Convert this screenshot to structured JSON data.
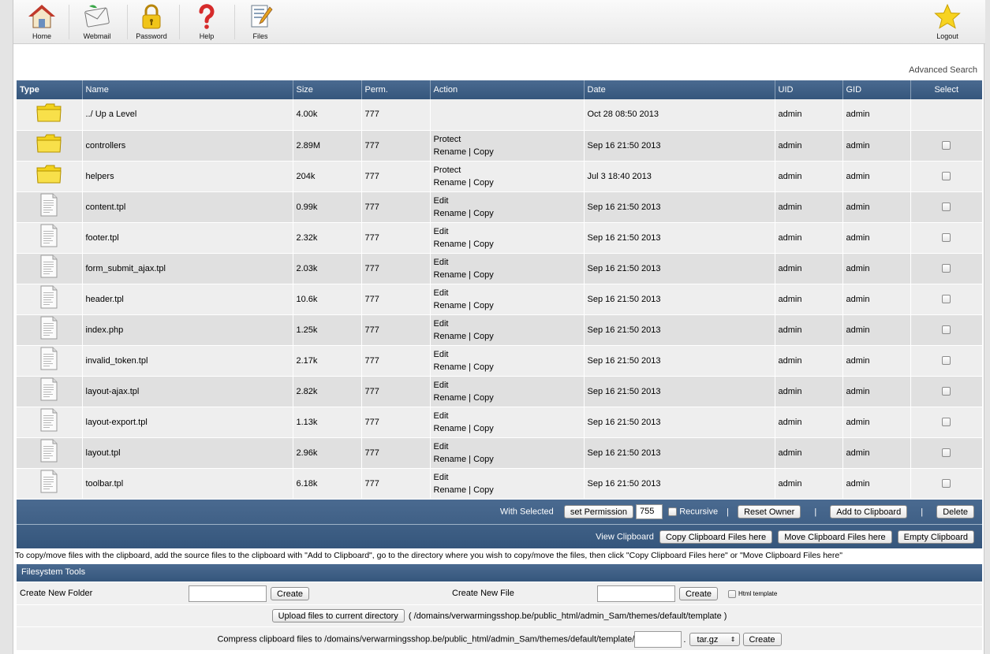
{
  "toolbar": {
    "items": [
      {
        "label": "Home",
        "icon": "home-icon"
      },
      {
        "label": "Webmail",
        "icon": "webmail-icon"
      },
      {
        "label": "Password",
        "icon": "lock-icon"
      },
      {
        "label": "Help",
        "icon": "help-icon"
      },
      {
        "label": "Files",
        "icon": "files-icon"
      }
    ],
    "logout": {
      "label": "Logout",
      "icon": "star-icon"
    }
  },
  "advanced_search": "Advanced Search",
  "columns": [
    "Type",
    "Name",
    "Size",
    "Perm.",
    "Action",
    "Date",
    "UID",
    "GID",
    "Select"
  ],
  "rows": [
    {
      "type": "folder",
      "name": "../ Up a Level",
      "size": "4.00k",
      "perm": "777",
      "action1": "",
      "action2": "",
      "action3": "",
      "date": "Oct 28 08:50 2013",
      "uid": "admin",
      "gid": "admin",
      "select": false
    },
    {
      "type": "folder",
      "name": "controllers",
      "size": "2.89M",
      "perm": "777",
      "action1": "Protect",
      "action2": "Rename",
      "action3": "Copy",
      "date": "Sep 16 21:50 2013",
      "uid": "admin",
      "gid": "admin",
      "select": true
    },
    {
      "type": "folder",
      "name": "helpers",
      "size": "204k",
      "perm": "777",
      "action1": "Protect",
      "action2": "Rename",
      "action3": "Copy",
      "date": "Jul 3 18:40 2013",
      "uid": "admin",
      "gid": "admin",
      "select": true
    },
    {
      "type": "file",
      "name": "content.tpl",
      "size": "0.99k",
      "perm": "777",
      "action1": "Edit",
      "action2": "Rename",
      "action3": "Copy",
      "date": "Sep 16 21:50 2013",
      "uid": "admin",
      "gid": "admin",
      "select": true
    },
    {
      "type": "file",
      "name": "footer.tpl",
      "size": "2.32k",
      "perm": "777",
      "action1": "Edit",
      "action2": "Rename",
      "action3": "Copy",
      "date": "Sep 16 21:50 2013",
      "uid": "admin",
      "gid": "admin",
      "select": true
    },
    {
      "type": "file",
      "name": "form_submit_ajax.tpl",
      "size": "2.03k",
      "perm": "777",
      "action1": "Edit",
      "action2": "Rename",
      "action3": "Copy",
      "date": "Sep 16 21:50 2013",
      "uid": "admin",
      "gid": "admin",
      "select": true
    },
    {
      "type": "file",
      "name": "header.tpl",
      "size": "10.6k",
      "perm": "777",
      "action1": "Edit",
      "action2": "Rename",
      "action3": "Copy",
      "date": "Sep 16 21:50 2013",
      "uid": "admin",
      "gid": "admin",
      "select": true
    },
    {
      "type": "file",
      "name": "index.php",
      "size": "1.25k",
      "perm": "777",
      "action1": "Edit",
      "action2": "Rename",
      "action3": "Copy",
      "date": "Sep 16 21:50 2013",
      "uid": "admin",
      "gid": "admin",
      "select": true
    },
    {
      "type": "file",
      "name": "invalid_token.tpl",
      "size": "2.17k",
      "perm": "777",
      "action1": "Edit",
      "action2": "Rename",
      "action3": "Copy",
      "date": "Sep 16 21:50 2013",
      "uid": "admin",
      "gid": "admin",
      "select": true
    },
    {
      "type": "file",
      "name": "layout-ajax.tpl",
      "size": "2.82k",
      "perm": "777",
      "action1": "Edit",
      "action2": "Rename",
      "action3": "Copy",
      "date": "Sep 16 21:50 2013",
      "uid": "admin",
      "gid": "admin",
      "select": true
    },
    {
      "type": "file",
      "name": "layout-export.tpl",
      "size": "1.13k",
      "perm": "777",
      "action1": "Edit",
      "action2": "Rename",
      "action3": "Copy",
      "date": "Sep 16 21:50 2013",
      "uid": "admin",
      "gid": "admin",
      "select": true
    },
    {
      "type": "file",
      "name": "layout.tpl",
      "size": "2.96k",
      "perm": "777",
      "action1": "Edit",
      "action2": "Rename",
      "action3": "Copy",
      "date": "Sep 16 21:50 2013",
      "uid": "admin",
      "gid": "admin",
      "select": true
    },
    {
      "type": "file",
      "name": "toolbar.tpl",
      "size": "6.18k",
      "perm": "777",
      "action1": "Edit",
      "action2": "Rename",
      "action3": "Copy",
      "date": "Sep 16 21:50 2013",
      "uid": "admin",
      "gid": "admin",
      "select": true
    }
  ],
  "action_separator": "|",
  "with_selected": {
    "label": "With Selected",
    "set_permission": "set Permission",
    "permission_value": "755",
    "recursive": "Recursive",
    "reset_owner": "Reset Owner",
    "add_to_clipboard": "Add to Clipboard",
    "delete": "Delete"
  },
  "clipboard": {
    "view": "View Clipboard",
    "copy_here": "Copy Clipboard Files here",
    "move_here": "Move Clipboard Files here",
    "empty": "Empty Clipboard"
  },
  "instructions": "To copy/move files with the clipboard, add the source files to the clipboard with \"Add to Clipboard\", go to the directory where you wish to copy/move the files, then click \"Copy Clipboard Files here\" or \"Move Clipboard Files here\"",
  "filesystem_tools": {
    "title": "Filesystem Tools",
    "new_folder_label": "Create New Folder",
    "new_folder_button": "Create",
    "new_file_label": "Create New File",
    "new_file_button": "Create",
    "html_template": "Html template",
    "upload_button": "Upload files to current directory",
    "upload_path": "( /domains/verwarmingsshop.be/public_html/admin_Sam/themes/default/template )",
    "compress_label": "Compress clipboard files to /domains/verwarmingsshop.be/public_html/admin_Sam/themes/default/template/",
    "compress_ext_sep": ".",
    "compress_format": "tar.gz",
    "compress_button": "Create"
  },
  "colors": {
    "header_blue": "#3f6088",
    "row_light": "#eeeeee",
    "row_dark": "#e0e0e0",
    "folder_yellow": "#f2d21c"
  }
}
